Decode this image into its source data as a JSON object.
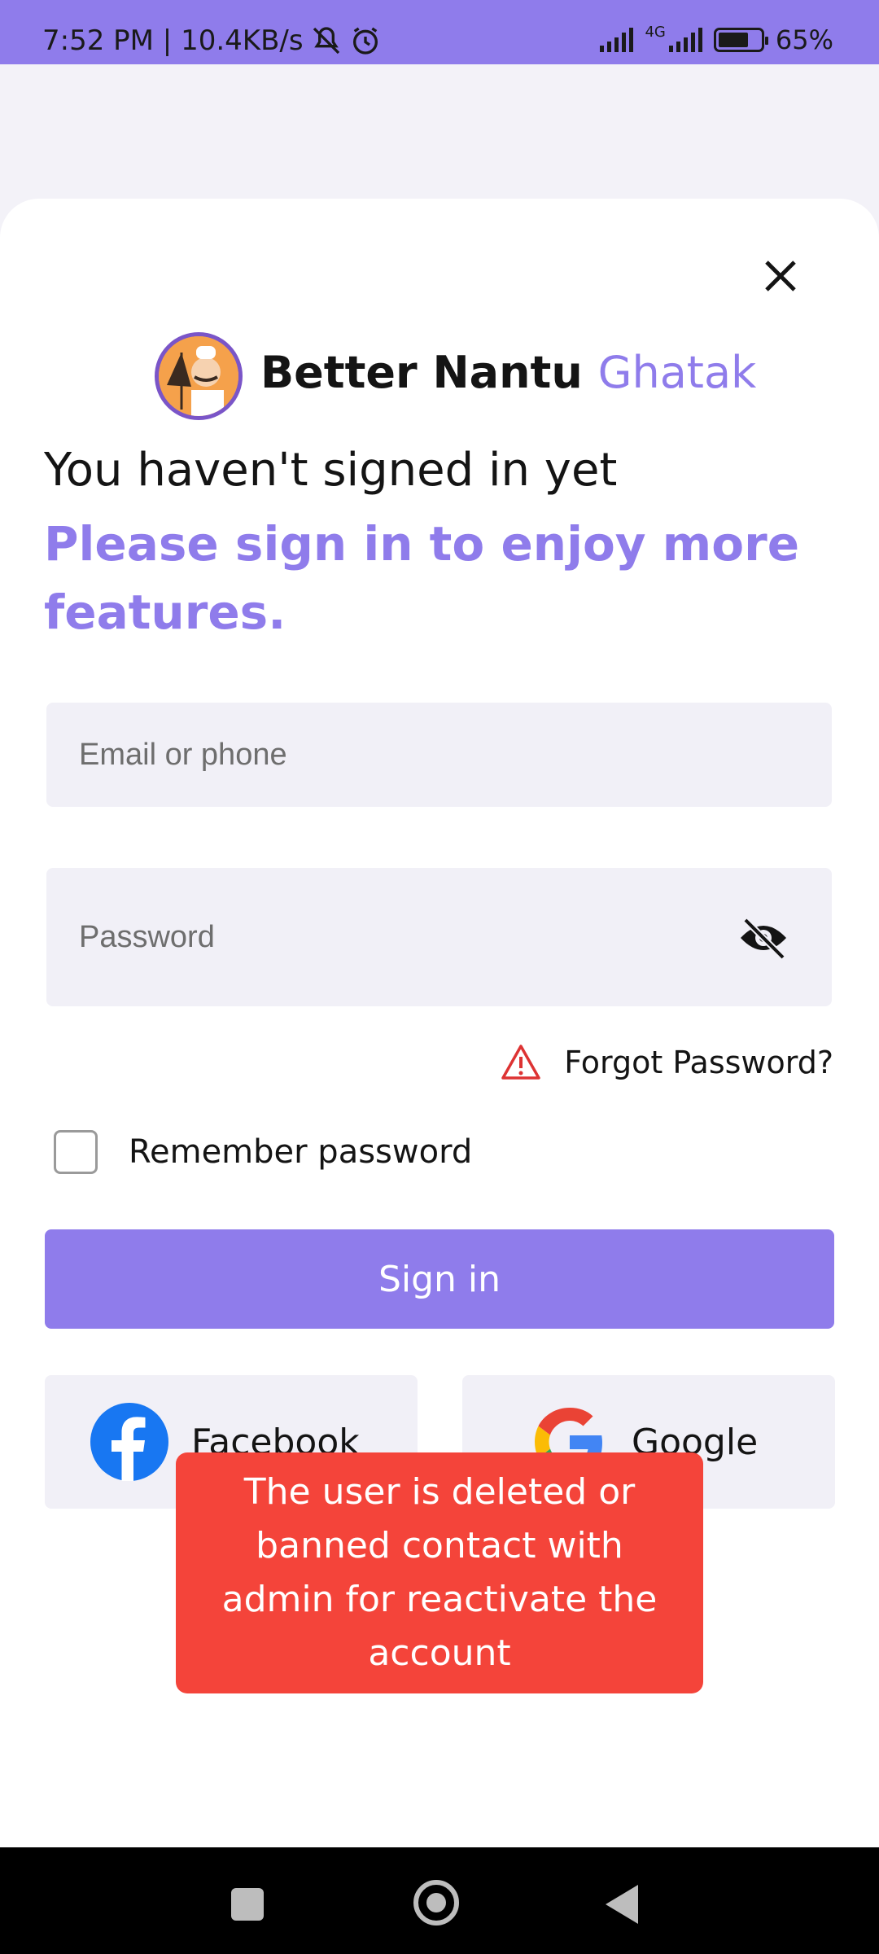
{
  "status_bar": {
    "time_speed": "7:52 PM | 10.4KB/s",
    "network": "4G",
    "battery": "65%"
  },
  "brand": {
    "name_part1": "Better Nantu",
    "name_part2": "Ghatak"
  },
  "login": {
    "heading": "You haven't signed in yet",
    "subheading": "Please sign in to enjoy more features.",
    "email_placeholder": "Email or phone",
    "password_placeholder": "Password",
    "forgot_password": "Forgot Password?",
    "remember_password": "Remember password",
    "sign_in_label": "Sign in",
    "facebook_label": "Facebook",
    "google_label": "Google"
  },
  "toast": {
    "message": "The user is deleted or banned contact with admin for reactivate the account"
  },
  "colors": {
    "accent": "#8f7ceb",
    "error": "#f4443a",
    "field_bg": "#f1f0f7"
  },
  "icons": [
    "mute-icon",
    "alarm-icon",
    "signal-icon",
    "battery-icon",
    "close-icon",
    "eye-off-icon",
    "warning-icon",
    "facebook-icon",
    "google-icon",
    "nav-recents-icon",
    "nav-home-icon",
    "nav-back-icon"
  ]
}
